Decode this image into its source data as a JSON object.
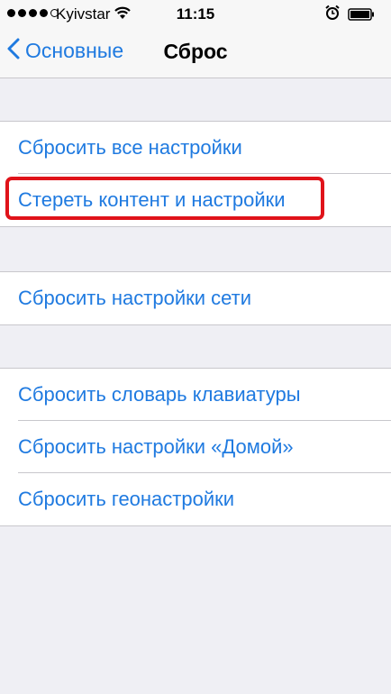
{
  "status_bar": {
    "carrier": "Kyivstar",
    "time": "11:15",
    "signal_bars_filled": 4,
    "signal_bars_total": 5,
    "icons": [
      "wifi-icon",
      "alarm-icon",
      "battery-icon"
    ]
  },
  "nav": {
    "back_label": "Основные",
    "title": "Сброс"
  },
  "groups": [
    {
      "items": [
        {
          "label": "Сбросить все настройки"
        },
        {
          "label": "Стереть контент и настройки",
          "highlighted": true
        }
      ]
    },
    {
      "items": [
        {
          "label": "Сбросить настройки сети"
        }
      ]
    },
    {
      "items": [
        {
          "label": "Сбросить словарь клавиатуры"
        },
        {
          "label": "Сбросить настройки «Домой»"
        },
        {
          "label": "Сбросить геонастройки"
        }
      ]
    }
  ],
  "colors": {
    "accent": "#1f7ae0",
    "highlight": "#e0131a",
    "background": "#efeff4"
  }
}
